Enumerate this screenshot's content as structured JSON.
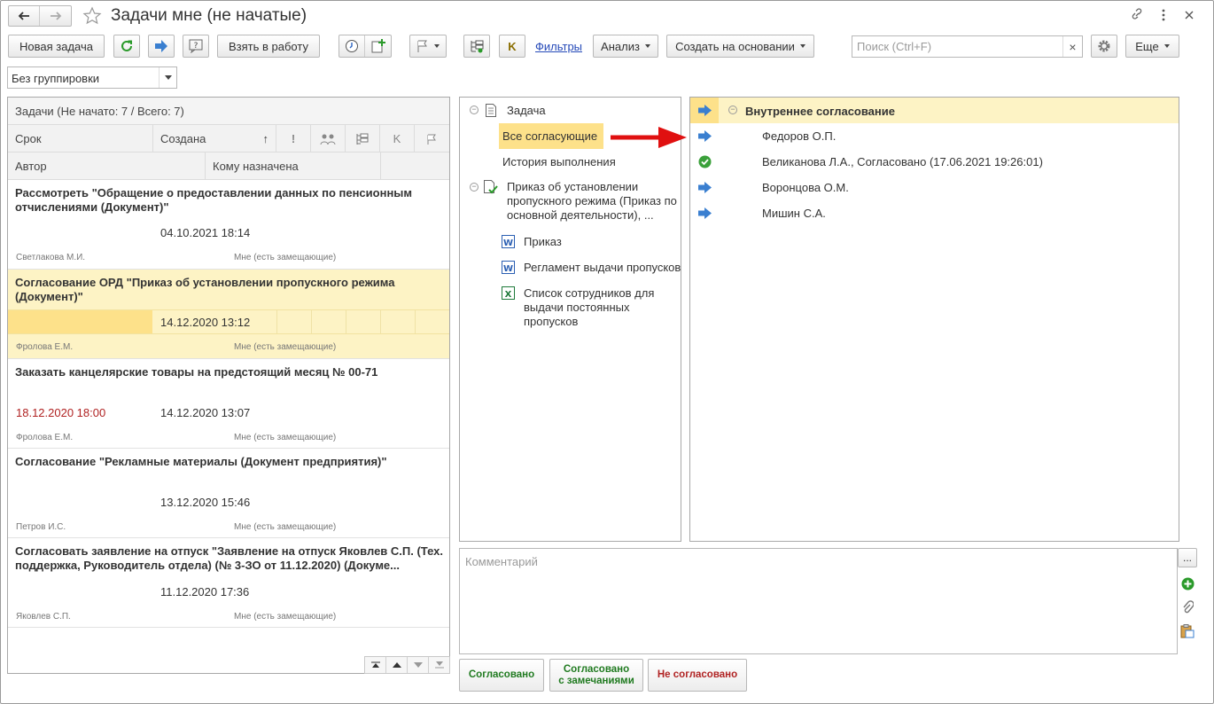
{
  "window": {
    "title": "Задачи мне (не начатые)"
  },
  "toolbar": {
    "new_task": "Новая задача",
    "take_to_work": "Взять в работу",
    "filters": "Фильтры",
    "analysis": "Анализ",
    "create_based_on": "Создать на основании",
    "search_placeholder": "Поиск (Ctrl+F)",
    "clear": "×",
    "more": "Еще",
    "k_label": "K"
  },
  "grouping": {
    "value": "Без группировки"
  },
  "task_list": {
    "summary": "Задачи (Не начато: 7 / Всего: 7)",
    "columns1": {
      "due": "Срок",
      "created": "Создана",
      "sort_arrow": "↑",
      "k": "K"
    },
    "columns2": {
      "author": "Автор",
      "assignee": "Кому назначена"
    },
    "rows": [
      {
        "title": "Рассмотреть \"Обращение о предоставлении данных по пенсионным отчислениями (Документ)\"",
        "due": "",
        "created": "04.10.2021 18:14",
        "author": "Светлакова М.И.",
        "assignee": "Мне (есть замещающие)"
      },
      {
        "title": "Согласование ОРД \"Приказ об установлении пропускного режима (Документ)\"",
        "due": "",
        "created": "14.12.2020 13:12",
        "author": "Фролова Е.М.",
        "assignee": "Мне (есть замещающие)"
      },
      {
        "title": "Заказать канцелярские товары на предстоящий месяц №  00-71",
        "due": "18.12.2020 18:00",
        "created": "14.12.2020 13:07",
        "author": "Фролова Е.М.",
        "assignee": "Мне (есть замещающие)"
      },
      {
        "title": "Согласование \"Рекламные материалы (Документ предприятия)\"",
        "due": "",
        "created": "13.12.2020 15:46",
        "author": "Петров И.С.",
        "assignee": "Мне (есть замещающие)"
      },
      {
        "title": "Согласовать заявление на отпуск \"Заявление на отпуск Яковлев С.П. (Тех. поддержка, Руководитель отдела) (№ 3-ЗО от 11.12.2020) (Докуме...",
        "due": "",
        "created": "11.12.2020 17:36",
        "author": "Яковлев С.П.",
        "assignee": "Мне (есть замещающие)"
      }
    ]
  },
  "tree": {
    "task": "Задача",
    "all_approvers": "Все согласующие",
    "history": "История выполнения",
    "document": "Приказ об установлении пропускного режима (Приказ по основной деятельности), ...",
    "files": [
      {
        "name": "Приказ",
        "type": "W"
      },
      {
        "name": "Регламент выдачи пропусков",
        "type": "W"
      },
      {
        "name": "Список сотрудников для выдачи постоянных пропусков",
        "type": "X"
      }
    ]
  },
  "approval": {
    "group": "Внутреннее согласование",
    "items": [
      {
        "name": "Федоров О.П.",
        "status": "pending"
      },
      {
        "name": "Великанова Л.А., Согласовано (17.06.2021 19:26:01)",
        "status": "approved"
      },
      {
        "name": "Воронцова О.М.",
        "status": "pending"
      },
      {
        "name": "Мишин С.А.",
        "status": "pending"
      }
    ]
  },
  "comment": {
    "placeholder": "Комментарий",
    "more": "..."
  },
  "actions": {
    "approved": "Согласовано",
    "approved_remarks_1": "Согласовано",
    "approved_remarks_2": "с замечаниями",
    "not_approved": "Не согласовано"
  },
  "colors": {
    "selection": "#fdf3c5",
    "selected_cell": "#fde18a",
    "approved": "#2f8a2f",
    "rejected": "#b02222",
    "link": "#2549b8",
    "arrow": "#e01010"
  }
}
